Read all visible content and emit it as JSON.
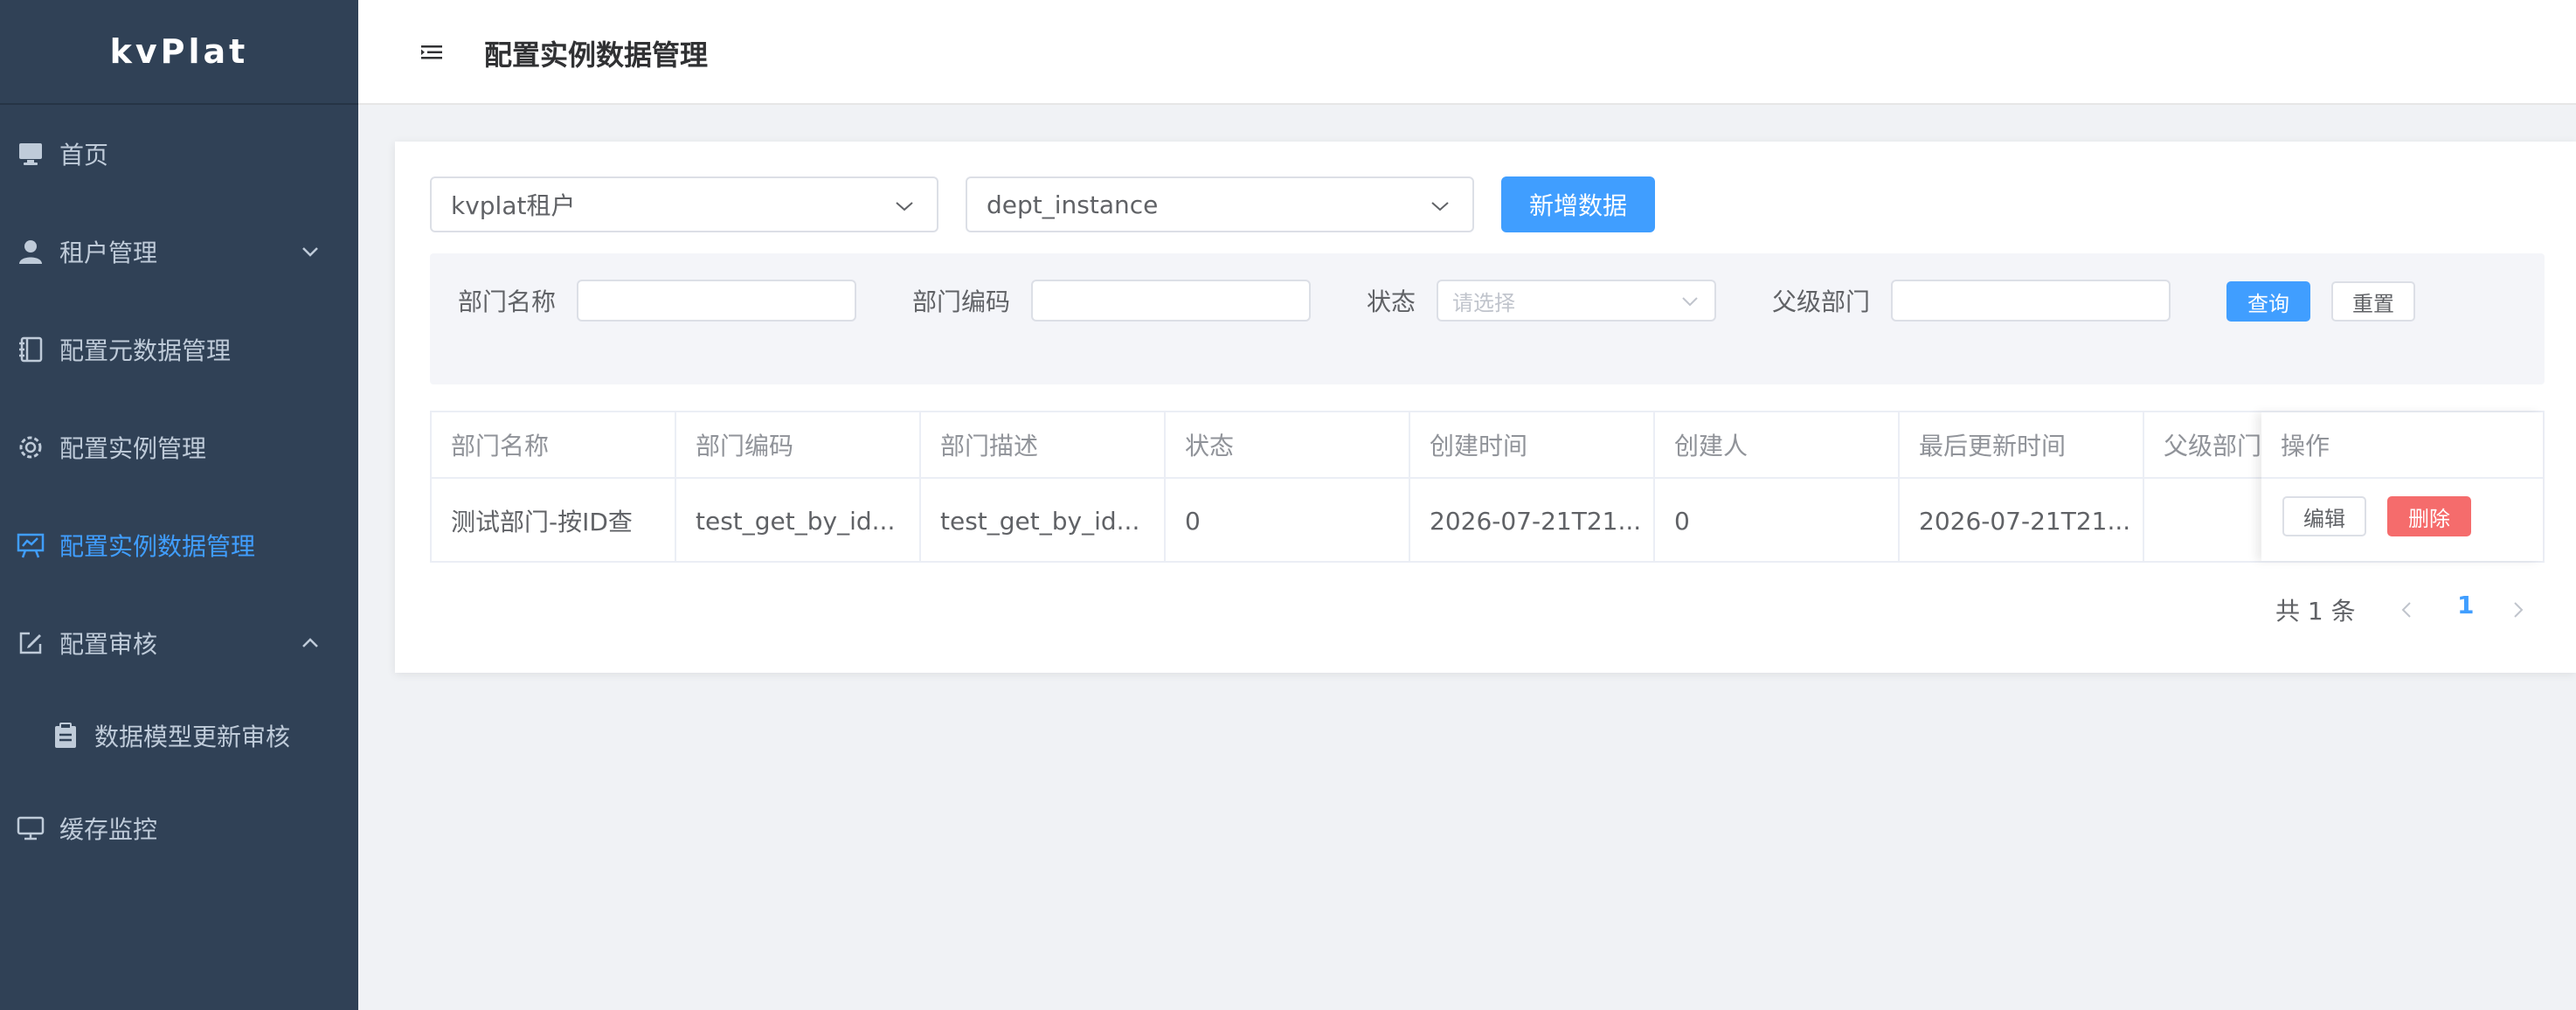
{
  "app": {
    "logo": "kvPlat"
  },
  "sidebar": {
    "items": [
      {
        "label": "首页",
        "icon": "monitor-icon"
      },
      {
        "label": "租户管理",
        "icon": "user-icon"
      },
      {
        "label": "配置元数据管理",
        "icon": "notebook-icon"
      },
      {
        "label": "配置实例管理",
        "icon": "gear-icon"
      },
      {
        "label": "配置实例数据管理",
        "icon": "data-board-icon"
      },
      {
        "label": "配置审核",
        "icon": "edit-icon"
      },
      {
        "label": "数据模型更新审核",
        "icon": "clipboard-icon"
      },
      {
        "label": "缓存监控",
        "icon": "monitor-icon"
      }
    ]
  },
  "header": {
    "title": "配置实例数据管理"
  },
  "toolbar": {
    "tenant_value": "kvplat租户",
    "model_value": "dept_instance",
    "add_label": "新增数据"
  },
  "filters": {
    "name_label": "部门名称",
    "code_label": "部门编码",
    "status_label": "状态",
    "status_placeholder": "请选择",
    "parent_label": "父级部门",
    "query_label": "查询",
    "reset_label": "重置"
  },
  "table": {
    "headers": [
      "部门名称",
      "部门编码",
      "部门描述",
      "状态",
      "创建时间",
      "创建人",
      "最后更新时间",
      "父级部门",
      "操作"
    ],
    "rows": [
      {
        "cells": [
          "测试部门-按ID查",
          "test_get_by_id...",
          "test_get_by_id...",
          "0",
          "2026-07-21T21...",
          "0",
          "2026-07-21T21...",
          ""
        ],
        "edit_label": "编辑",
        "delete_label": "删除"
      }
    ]
  },
  "pagination": {
    "total_text": "共 1 条",
    "current_page": "1"
  },
  "colors": {
    "primary": "#409eff",
    "danger": "#f56c6c",
    "sidebar_bg": "#304156"
  }
}
